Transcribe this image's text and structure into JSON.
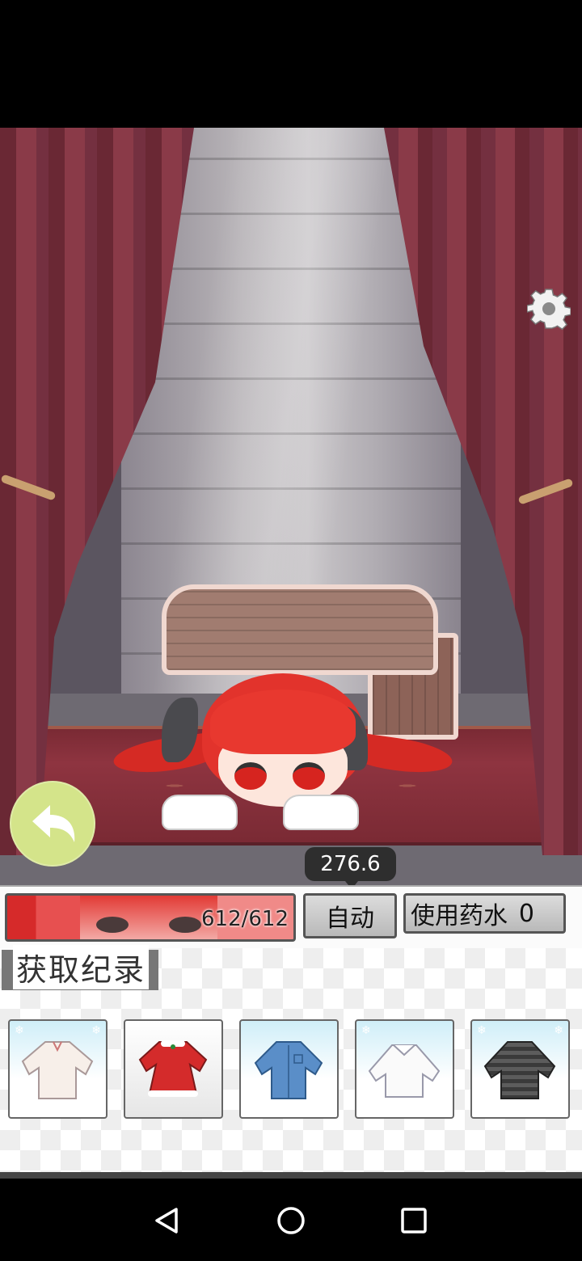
{
  "game": {
    "damage_popup": "276.6",
    "hp": {
      "text": "612/612",
      "fraction": 1.0
    },
    "auto_button": "自动",
    "potion_button": {
      "label": "使用药水",
      "count": "0"
    },
    "records_title": "获取纪录",
    "items": [
      {
        "name": "white-blouse"
      },
      {
        "name": "santa-dress"
      },
      {
        "name": "blue-shirt-dress"
      },
      {
        "name": "white-collar-shirt"
      },
      {
        "name": "striped-sweater"
      }
    ]
  },
  "colors": {
    "back_button": "#d4e48a",
    "hp_fill": "#d62a2a",
    "curtain": "#8a3a48"
  },
  "icons": {
    "settings": "gear-icon",
    "back": "back-arrow-icon",
    "nav_back": "triangle-back-icon",
    "nav_home": "circle-home-icon",
    "nav_recent": "square-recent-icon"
  }
}
